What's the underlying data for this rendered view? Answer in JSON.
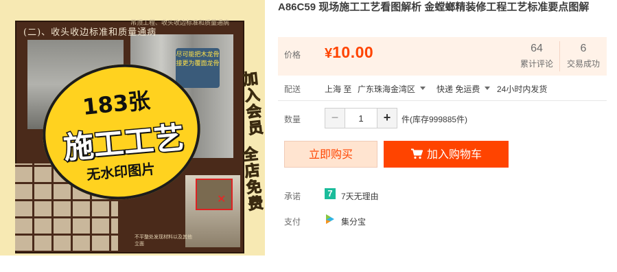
{
  "product_image": {
    "header": "(二)、收头收边标准和质量通病",
    "subheader": "吊顶工程、收头收边标准和质量通病",
    "note": "尽可能把木龙骨接更为覆面龙骨",
    "badge_line1": "183张",
    "badge_line2": "施工工艺",
    "badge_line3": "无水印图片",
    "side_text_1": "加入会员",
    "side_text_2": "全店免费",
    "bottom_text": "不平整处发现材料以及其他立面"
  },
  "product": {
    "title": "A86C59 现场施工工艺看图解析 金螳螂精装修工程工艺标准要点图解"
  },
  "price": {
    "label": "价格",
    "currency": "¥",
    "amount": "10.00",
    "reviews_count": "64",
    "reviews_label": "累计评论",
    "sales_count": "6",
    "sales_label": "交易成功"
  },
  "shipping": {
    "label": "配送",
    "from": "上海 至",
    "to": "广东珠海金湾区",
    "method": "快递 免运费",
    "time": "24小时内发货"
  },
  "quantity": {
    "label": "数量",
    "minus": "−",
    "value": "1",
    "plus": "+",
    "stock": "件(库存999885件)"
  },
  "buttons": {
    "buy_now": "立即购买",
    "add_to_cart": "加入购物车"
  },
  "promise": {
    "label": "承诺",
    "icon_text": "7",
    "text": "7天无理由"
  },
  "payment": {
    "label": "支付",
    "text": "集分宝"
  },
  "colors": {
    "accent": "#ff4400",
    "price_bg": "#fff2e8",
    "promise_icon": "#1bbc9b"
  }
}
